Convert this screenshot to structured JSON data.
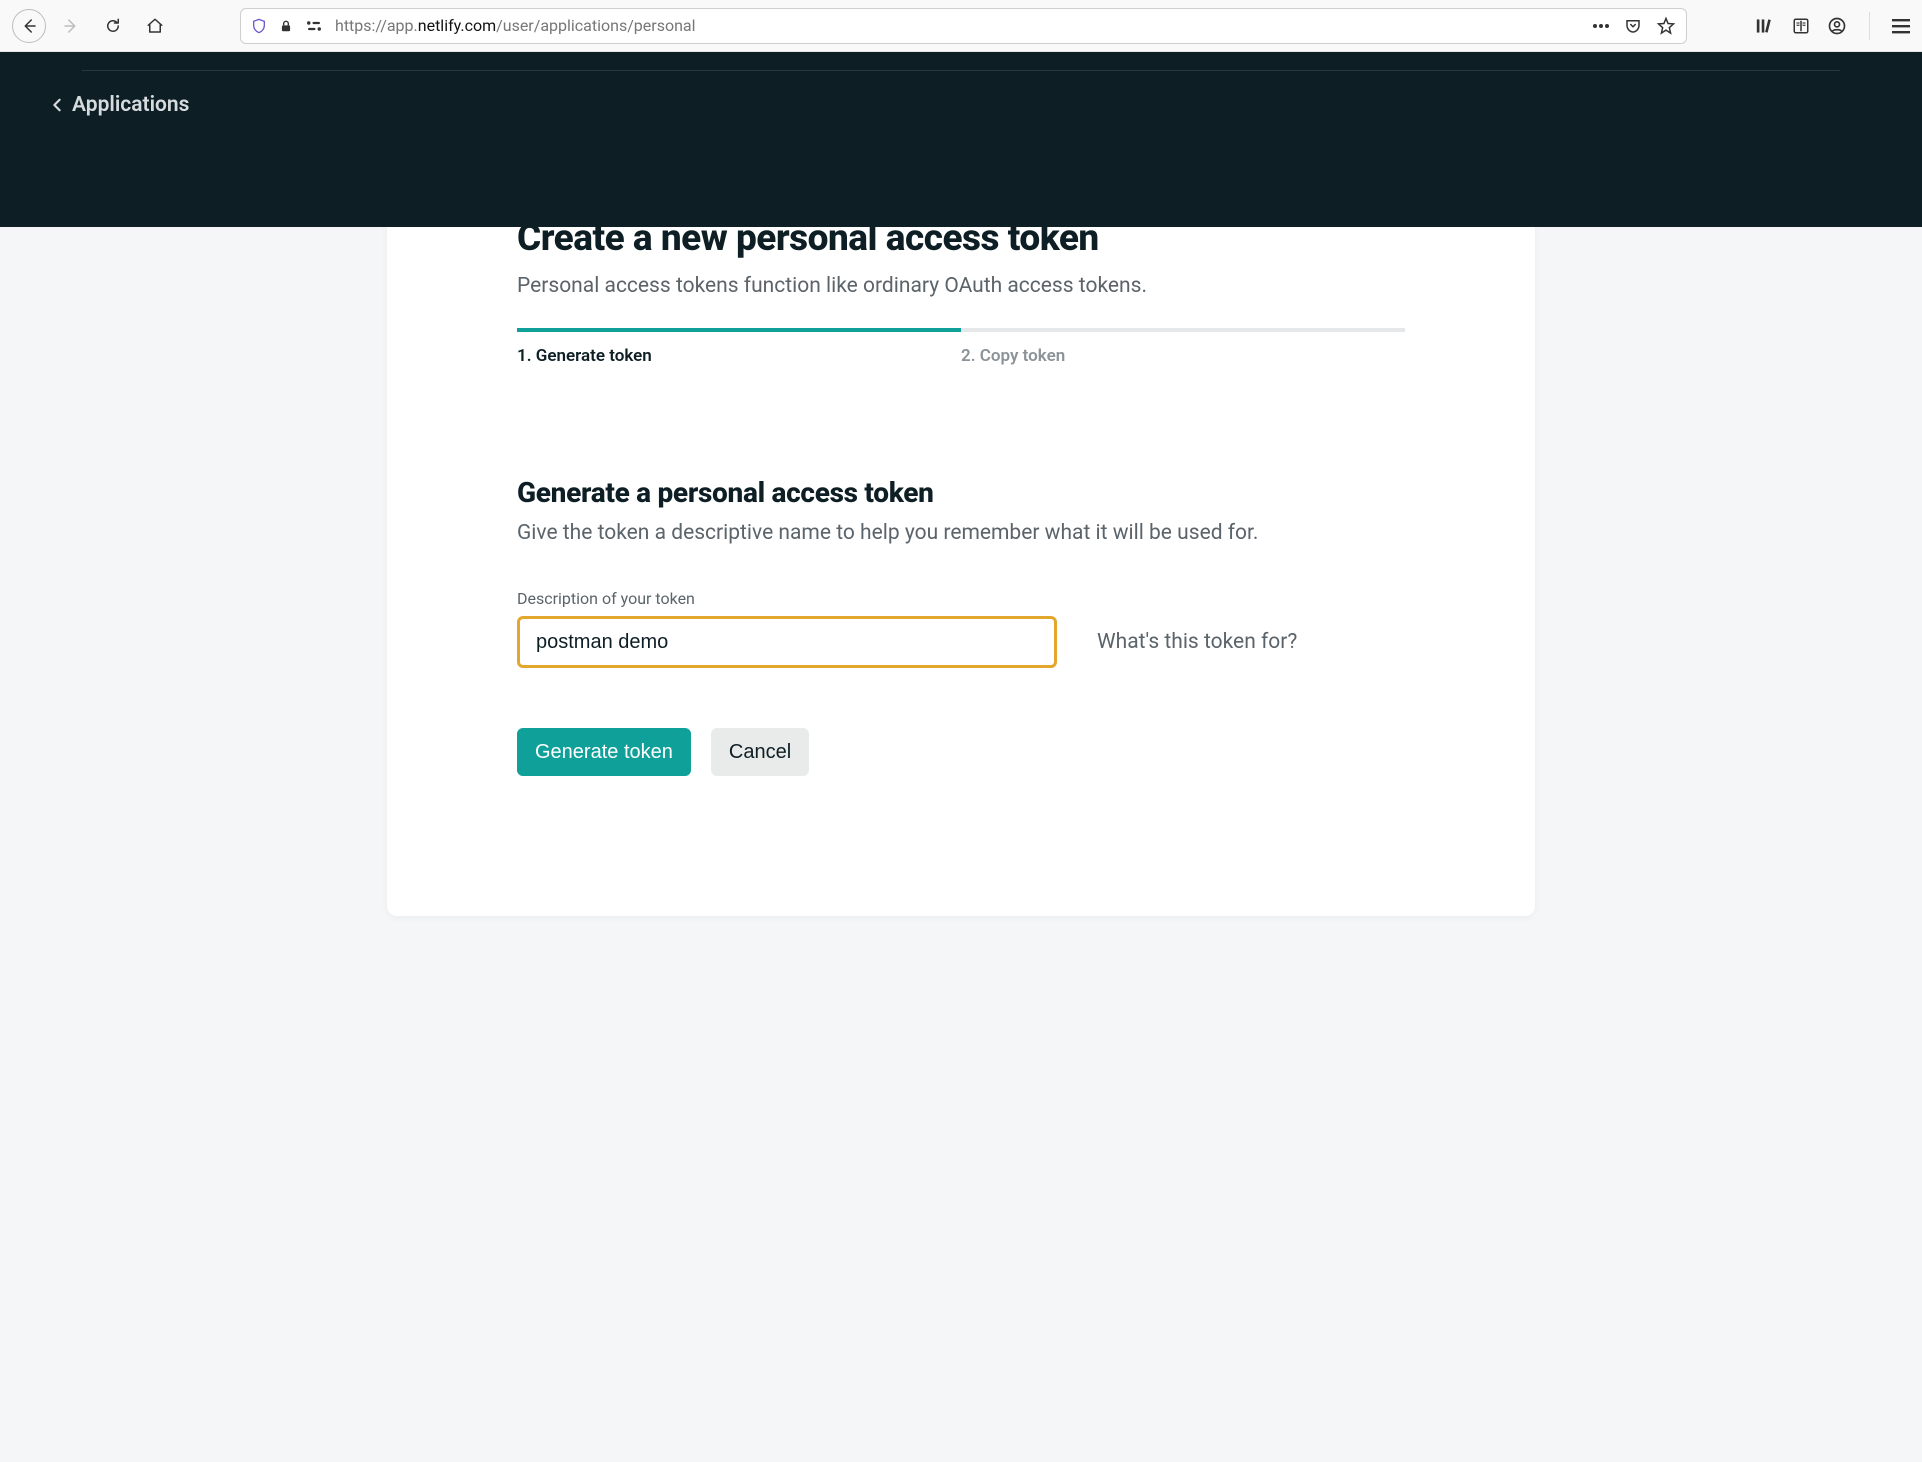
{
  "browser": {
    "url_prefix": "https://app.",
    "url_domain": "netlify.com",
    "url_path": "/user/applications/personal"
  },
  "header": {
    "breadcrumb": "Applications"
  },
  "page": {
    "title": "Create a new personal access token",
    "subtitle": "Personal access tokens function like ordinary OAuth access tokens."
  },
  "stepper": {
    "step1": "1. Generate token",
    "step2": "2. Copy token"
  },
  "section": {
    "title": "Generate a personal access token",
    "subtitle": "Give the token a descriptive name to help you remember what it will be used for.",
    "field_label": "Description of your token",
    "field_value": "postman demo",
    "field_hint": "What's this token for?"
  },
  "buttons": {
    "primary": "Generate token",
    "secondary": "Cancel"
  }
}
